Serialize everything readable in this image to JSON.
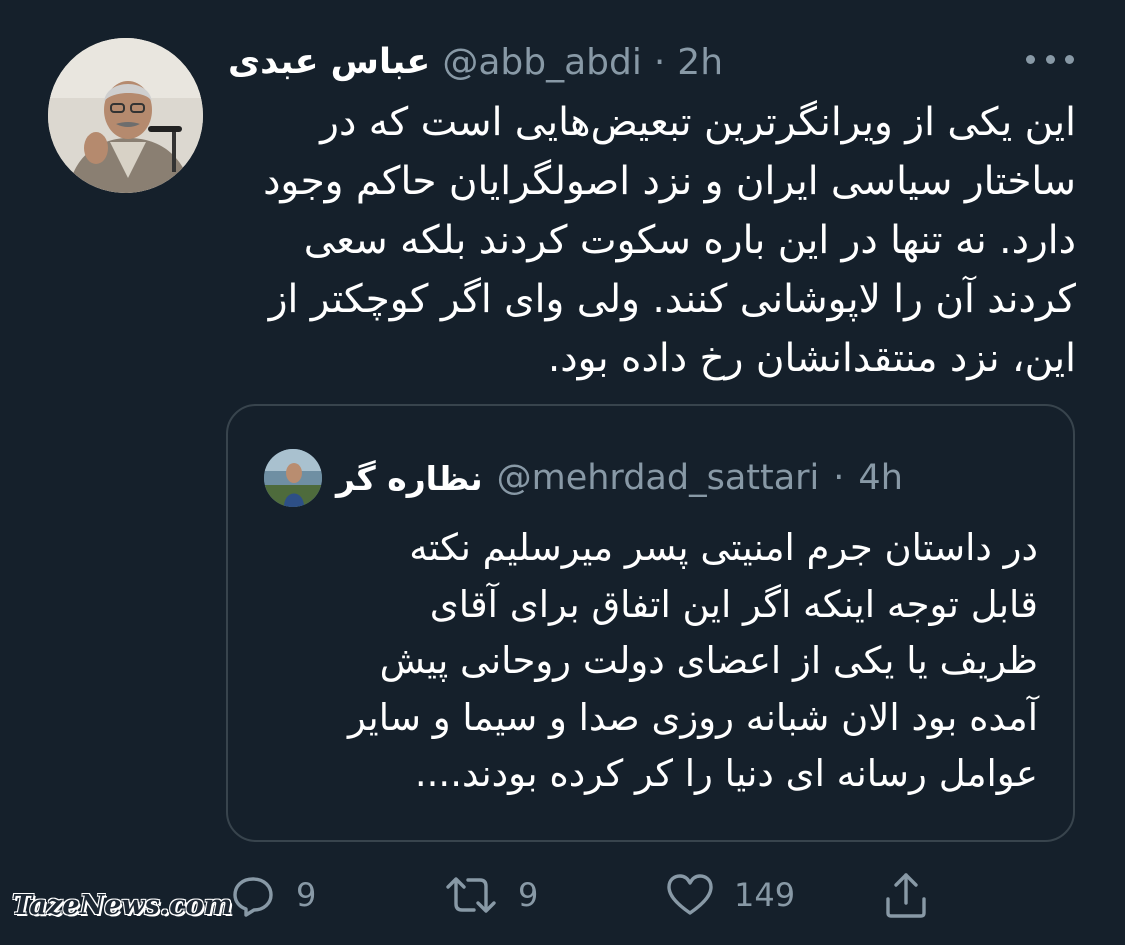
{
  "tweet": {
    "author_name": "عباس عبدی",
    "handle": "@abb_abdi",
    "separator": "·",
    "time": "2h",
    "lines": [
      "این یکی از ویرانگرترین تبعیض‌هایی است که در",
      "ساختار سیاسی ایران و نزد اصولگرایان حاکم وجود",
      "دارد. نه تنها در این باره سکوت کردند بلکه سعی",
      "کردند آن را لاپوشانی کنند. ولی وای اگر کوچکتر از",
      "این، نزد منتقدانشان رخ داده بود."
    ]
  },
  "quoted": {
    "author_name": "نظاره گر",
    "handle": "@mehrdad_sattari",
    "separator": "·",
    "time": "4h",
    "lines": [
      "در داستان جرم امنیتی پسر میرسلیم نکته",
      "قابل توجه اینکه اگر این اتفاق برای آقای",
      "ظریف یا یکی از اعضای دولت روحانی پیش",
      "آمده بود الان شبانه روزی صدا و سیما و سایر",
      "عوامل رسانه ای دنیا را کر کرده بودند...."
    ]
  },
  "actions": {
    "reply_count": "9",
    "retweet_count": "9",
    "like_count": "149"
  },
  "icons": [
    "more-icon",
    "reply-icon",
    "retweet-icon",
    "like-icon",
    "share-icon"
  ],
  "colors": {
    "background": "#15202b",
    "secondary_text": "#8899a6",
    "border": "#38444d"
  },
  "watermark": "TazeNews.com"
}
